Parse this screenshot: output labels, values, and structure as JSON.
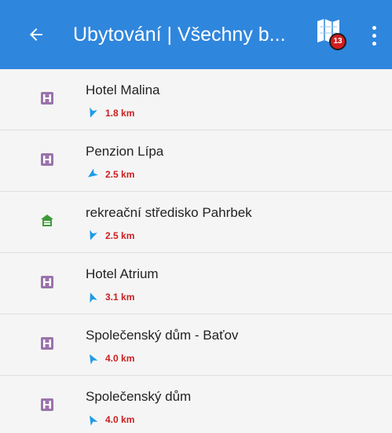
{
  "header": {
    "title": "Ubytování | Všechny b...",
    "map_badge": "13"
  },
  "colors": {
    "app_bar": "#2f86dd",
    "distance": "#cc1f1f",
    "arrow": "#1e9be6",
    "hotel_icon": "#8a5c9e",
    "recreation_icon": "#3f9a3a"
  },
  "places": [
    {
      "name": "Hotel Malina",
      "distance": "1.8 km",
      "icon": "hotel-icon",
      "bearing_deg": 200
    },
    {
      "name": "Penzion Lípa",
      "distance": "2.5 km",
      "icon": "hotel-icon",
      "bearing_deg": 235
    },
    {
      "name": "rekreační středisko Pahrbek",
      "distance": "2.5 km",
      "icon": "recreation-center-icon",
      "bearing_deg": 200
    },
    {
      "name": "Hotel Atrium",
      "distance": "3.1 km",
      "icon": "hotel-icon",
      "bearing_deg": 340
    },
    {
      "name": "Společenský dům - Baťov",
      "distance": "4.0 km",
      "icon": "hotel-icon",
      "bearing_deg": 330
    },
    {
      "name": "Společenský dům",
      "distance": "4.0 km",
      "icon": "hotel-icon",
      "bearing_deg": 330
    }
  ]
}
